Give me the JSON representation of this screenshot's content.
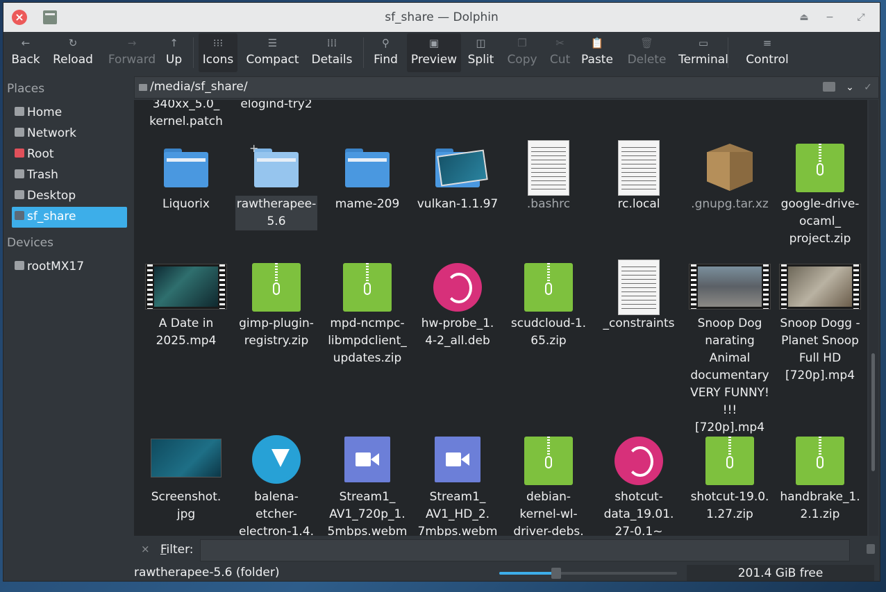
{
  "window": {
    "title": "sf_share — Dolphin",
    "close": "×"
  },
  "toolbar": [
    {
      "label": "Back",
      "icon": "arrow-left-icon",
      "glyph": "←",
      "disabled": false
    },
    {
      "label": "Reload",
      "icon": "reload-icon",
      "glyph": "↻",
      "disabled": false
    },
    {
      "label": "Forward",
      "icon": "arrow-right-icon",
      "glyph": "→",
      "disabled": true
    },
    {
      "label": "Up",
      "icon": "arrow-up-icon",
      "glyph": "↑",
      "disabled": false
    },
    {
      "label": "Icons",
      "icon": "icons-view-icon",
      "glyph": "⁝⁝⁝",
      "active": true
    },
    {
      "label": "Compact",
      "icon": "compact-view-icon",
      "glyph": "☰"
    },
    {
      "label": "Details",
      "icon": "details-view-icon",
      "glyph": "⁞⁞⁞"
    },
    {
      "label": "Find",
      "icon": "search-icon",
      "glyph": "⚲"
    },
    {
      "label": "Preview",
      "icon": "preview-icon",
      "glyph": "▣",
      "active": true
    },
    {
      "label": "Split",
      "icon": "split-icon",
      "glyph": "◫"
    },
    {
      "label": "Copy",
      "icon": "copy-icon",
      "glyph": "❐",
      "disabled": true
    },
    {
      "label": "Cut",
      "icon": "scissors-icon",
      "glyph": "✂",
      "disabled": true
    },
    {
      "label": "Paste",
      "icon": "paste-icon",
      "glyph": "📋"
    },
    {
      "label": "Delete",
      "icon": "trash-icon",
      "glyph": "🗑",
      "disabled": true
    },
    {
      "label": "Terminal",
      "icon": "terminal-icon",
      "glyph": "▭"
    },
    {
      "label": "Control",
      "icon": "menu-icon",
      "glyph": "≡"
    }
  ],
  "places": {
    "heading": "Places",
    "items": [
      "Home",
      "Network",
      "Root",
      "Trash",
      "Desktop",
      "sf_share"
    ],
    "selected": "sf_share",
    "devices_heading": "Devices",
    "devices": [
      "rootMX17"
    ]
  },
  "location": {
    "path": "/media/sf_share/"
  },
  "files": {
    "partial_top": [
      {
        "name": "340xx_5.0_ kernel.patch"
      },
      {
        "name": "elogind-try2"
      }
    ],
    "rows": [
      [
        {
          "name": "Liquorix",
          "type": "folder"
        },
        {
          "name": "rawtherapee-5.6",
          "type": "folder-selected"
        },
        {
          "name": "mame-209",
          "type": "folder"
        },
        {
          "name": "vulkan-1.1.97",
          "type": "folder-preview"
        },
        {
          "name": ".bashrc",
          "type": "text",
          "dim": true
        },
        {
          "name": "rc.local",
          "type": "text"
        },
        {
          "name": ".gnupg.tar.xz",
          "type": "package",
          "dim": true
        },
        {
          "name": "google-drive-ocaml_ project.zip",
          "type": "zip"
        }
      ],
      [
        {
          "name": "A Date in 2025.mp4",
          "type": "video"
        },
        {
          "name": "gimp-plugin-registry.zip",
          "type": "zip"
        },
        {
          "name": "mpd-ncmpc-libmpdclient_ updates.zip",
          "type": "zip"
        },
        {
          "name": "hw-probe_1. 4-2_all.deb",
          "type": "debian"
        },
        {
          "name": "scudcloud-1. 65.zip",
          "type": "zip"
        },
        {
          "name": "_constraints",
          "type": "text"
        },
        {
          "name": "Snoop Dog narating Animal documentary VERY FUNNY! !!! [720p].mp4",
          "type": "video"
        },
        {
          "name": "Snoop Dogg - Planet Snoop Full HD [720p].mp4",
          "type": "video"
        }
      ],
      [
        {
          "name": "Screenshot. jpg",
          "type": "image"
        },
        {
          "name": "balena-etcher-electron-1.4.",
          "type": "installer"
        },
        {
          "name": "Stream1_ AV1_720p_1. 5mbps.webm",
          "type": "webm"
        },
        {
          "name": "Stream1_ AV1_HD_2. 7mbps.webm",
          "type": "webm"
        },
        {
          "name": "debian-kernel-wl-driver-debs.",
          "type": "zip"
        },
        {
          "name": "shotcut-data_19.01. 27-0.1~",
          "type": "debian"
        },
        {
          "name": "shotcut-19.0. 1.27.zip",
          "type": "zip"
        },
        {
          "name": "handbrake_1. 2.1.zip",
          "type": "zip"
        }
      ]
    ]
  },
  "filter": {
    "close": "×",
    "label_prefix": "F",
    "label_rest": "ilter:",
    "value": ""
  },
  "status": {
    "text": "rawtherapee-5.6 (folder)",
    "free": "201.4 GiB free",
    "zoom_fraction": 0.32
  }
}
